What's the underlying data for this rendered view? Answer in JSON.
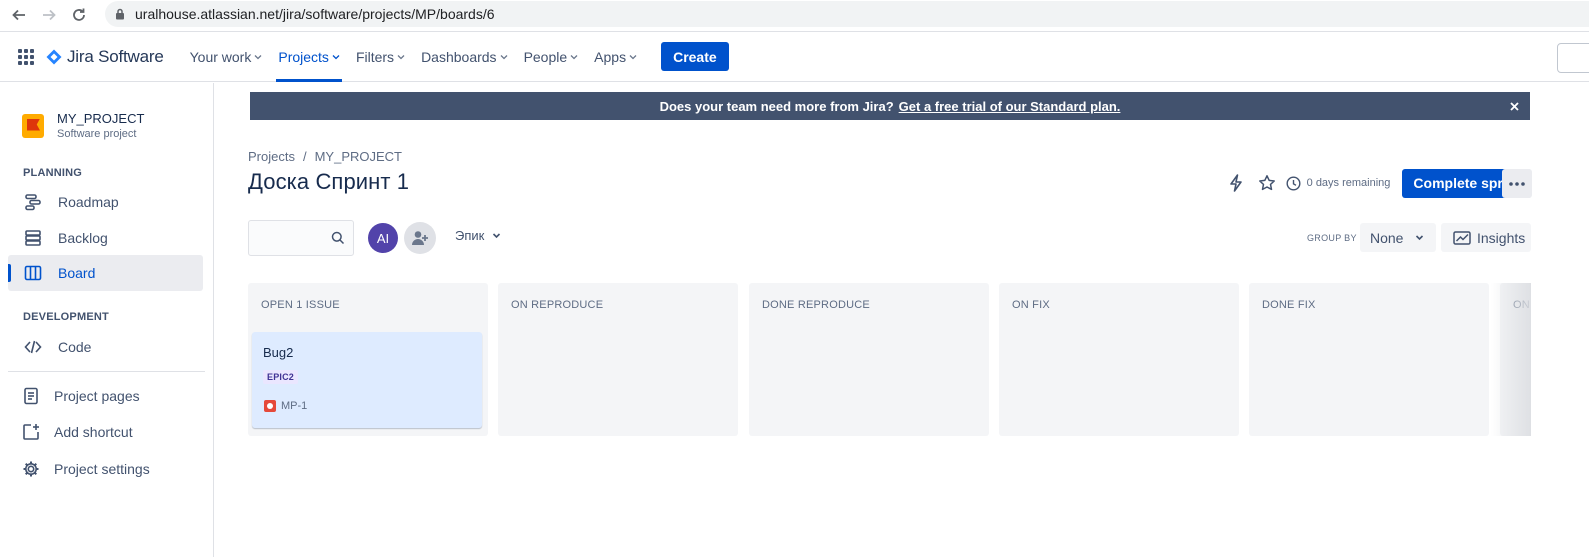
{
  "browser": {
    "url": "uralhouse.atlassian.net/jira/software/projects/MP/boards/6"
  },
  "topnav": {
    "product": "Jira Software",
    "items": [
      {
        "label": "Your work",
        "active": false
      },
      {
        "label": "Projects",
        "active": true
      },
      {
        "label": "Filters",
        "active": false
      },
      {
        "label": "Dashboards",
        "active": false
      },
      {
        "label": "People",
        "active": false
      },
      {
        "label": "Apps",
        "active": false
      }
    ],
    "create": "Create"
  },
  "sidebar": {
    "project_name": "MY_PROJECT",
    "project_type": "Software project",
    "planning_heading": "PLANNING",
    "development_heading": "DEVELOPMENT",
    "items": {
      "roadmap": "Roadmap",
      "backlog": "Backlog",
      "board": "Board",
      "code": "Code",
      "project_pages": "Project pages",
      "add_shortcut": "Add shortcut",
      "project_settings": "Project settings"
    }
  },
  "banner": {
    "text": "Does your team need more from Jira?",
    "link": "Get a free trial of our Standard plan."
  },
  "breadcrumb": {
    "projects": "Projects",
    "separator": "/",
    "project": "MY_PROJECT"
  },
  "page_title": "Доска Спринт 1",
  "header": {
    "days_remaining": "0 days remaining",
    "complete_sprint": "Complete sprint"
  },
  "toolbar": {
    "avatar_initials": "AI",
    "epic_filter": "Эпик",
    "group_by_label": "GROUP BY",
    "group_by_value": "None",
    "insights": "Insights"
  },
  "board": {
    "columns": [
      {
        "title": "OPEN 1 ISSUE"
      },
      {
        "title": "ON REPRODUCE"
      },
      {
        "title": "DONE REPRODUCE"
      },
      {
        "title": "ON FIX"
      },
      {
        "title": "DONE FIX"
      },
      {
        "title": "ON"
      }
    ],
    "card": {
      "title": "Bug2",
      "epic": "EPIC2",
      "key": "MP-1"
    }
  },
  "colors": {
    "primary": "#0052cc",
    "banner": "#42526e",
    "card": "#deebff",
    "column": "#f4f5f7"
  }
}
